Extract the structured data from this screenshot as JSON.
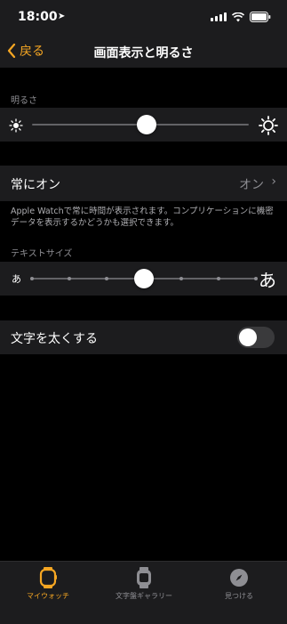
{
  "status": {
    "time": "18:00",
    "location_icon": "location-arrow-icon",
    "signal_icon": "cellular-signal-icon",
    "wifi_icon": "wifi-icon",
    "battery_icon": "battery-icon"
  },
  "nav": {
    "back_label": "戻る",
    "title": "画面表示と明るさ"
  },
  "brightness": {
    "section_label": "明るさ",
    "level": 0.53,
    "low_icon": "sun-small-icon",
    "high_icon": "sun-large-icon"
  },
  "always_on": {
    "label": "常にオン",
    "value": "オン",
    "note": "Apple Watchで常に時間が表示されます。コンプリケーションに機密データを表示するかどうかも選択できます。"
  },
  "text_size": {
    "section_label": "テキストサイズ",
    "small_glyph": "あ",
    "large_glyph": "あ",
    "steps": 7,
    "selected_step": 4
  },
  "bold_text": {
    "label": "文字を太くする",
    "enabled": false
  },
  "tabs": [
    {
      "label": "マイウォッチ",
      "icon": "watch-icon",
      "active": true
    },
    {
      "label": "文字盤ギャラリー",
      "icon": "watch-face-icon",
      "active": false
    },
    {
      "label": "見つける",
      "icon": "compass-icon",
      "active": false
    }
  ],
  "colors": {
    "accent": "#f5a623",
    "background": "#000000",
    "cell": "#1c1c1e",
    "secondary_text": "#8e8e93"
  }
}
